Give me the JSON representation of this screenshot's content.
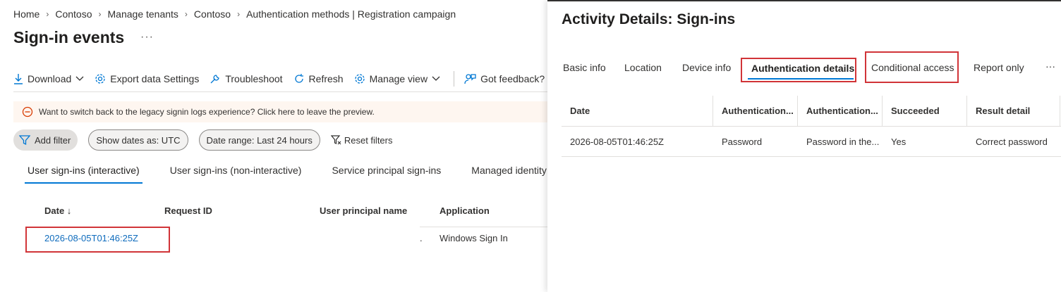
{
  "breadcrumb": [
    "Home",
    "Contoso",
    "Manage tenants",
    "Contoso",
    "Authentication methods | Registration campaign"
  ],
  "page": {
    "title": "Sign-in events",
    "more": "···"
  },
  "toolbar": {
    "download": "Download",
    "export": "Export data Settings",
    "troubleshoot": "Troubleshoot",
    "refresh": "Refresh",
    "manage_view": "Manage view",
    "feedback": "Got feedback?"
  },
  "banner": {
    "text": "Want to switch back to the legacy signin logs experience? Click here to leave the preview."
  },
  "filters": {
    "add": "Add filter",
    "dates_as": "Show dates as: UTC",
    "range": "Date range: Last 24 hours",
    "reset": "Reset filters"
  },
  "tabs": [
    "User sign-ins (interactive)",
    "User sign-ins (non-interactive)",
    "Service principal sign-ins",
    "Managed identity sig"
  ],
  "grid": {
    "columns": [
      "Date ↓",
      "Request ID",
      "User principal name",
      "Application"
    ],
    "rows": [
      {
        "date": "2026-08-05T01:46:25Z",
        "dot": ".",
        "application": "Windows Sign In"
      }
    ]
  },
  "panel": {
    "title": "Activity Details: Sign-ins",
    "tabs": [
      "Basic info",
      "Location",
      "Device info",
      "Authentication details",
      "Conditional access",
      "Report only",
      "···"
    ],
    "columns": [
      "Date",
      "Authentication...",
      "Authentication...",
      "Succeeded",
      "Result detail"
    ],
    "rows": [
      [
        "2026-08-05T01:46:25Z",
        "Password",
        "Password in the...",
        "Yes",
        "Correct password"
      ]
    ]
  },
  "colors": {
    "accent": "#0078d4",
    "highlight": "#d13438",
    "banner_bg": "#fef6f0",
    "link": "#0f6cbd"
  }
}
